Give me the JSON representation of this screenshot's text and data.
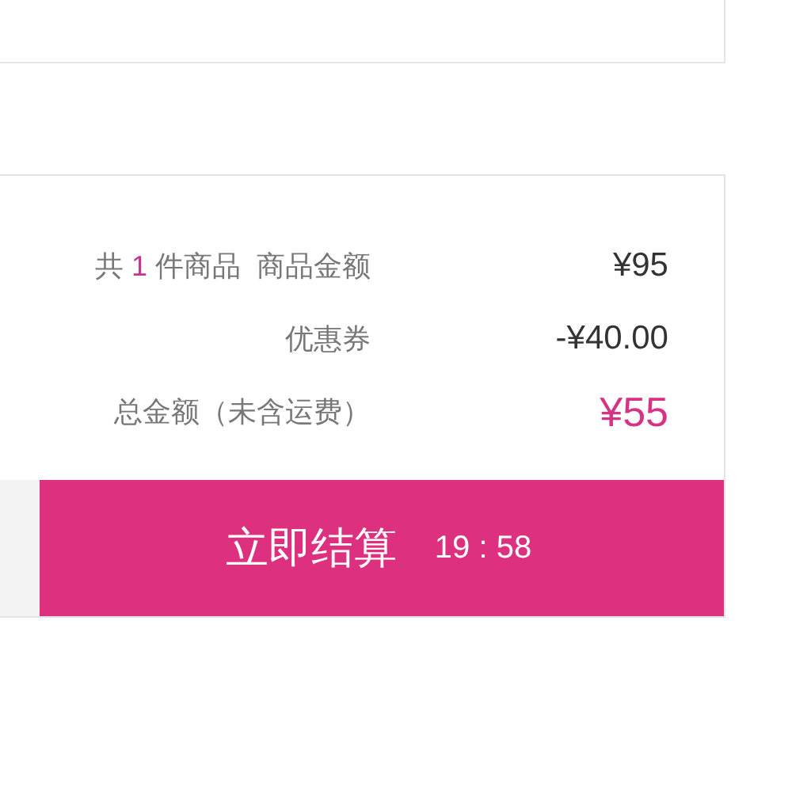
{
  "summary": {
    "item_count": {
      "prefix": "共",
      "count": "1",
      "suffix": "件商品"
    },
    "rows": [
      {
        "kind": "subtotal",
        "label": "商品金额",
        "value": "¥95"
      },
      {
        "kind": "discount",
        "label": "优惠券",
        "value": "-¥40.00"
      },
      {
        "kind": "total",
        "label": "总金额（未含运费）",
        "value": "¥55"
      }
    ]
  },
  "checkout": {
    "label": "立即结算",
    "timer": "19 : 58"
  }
}
